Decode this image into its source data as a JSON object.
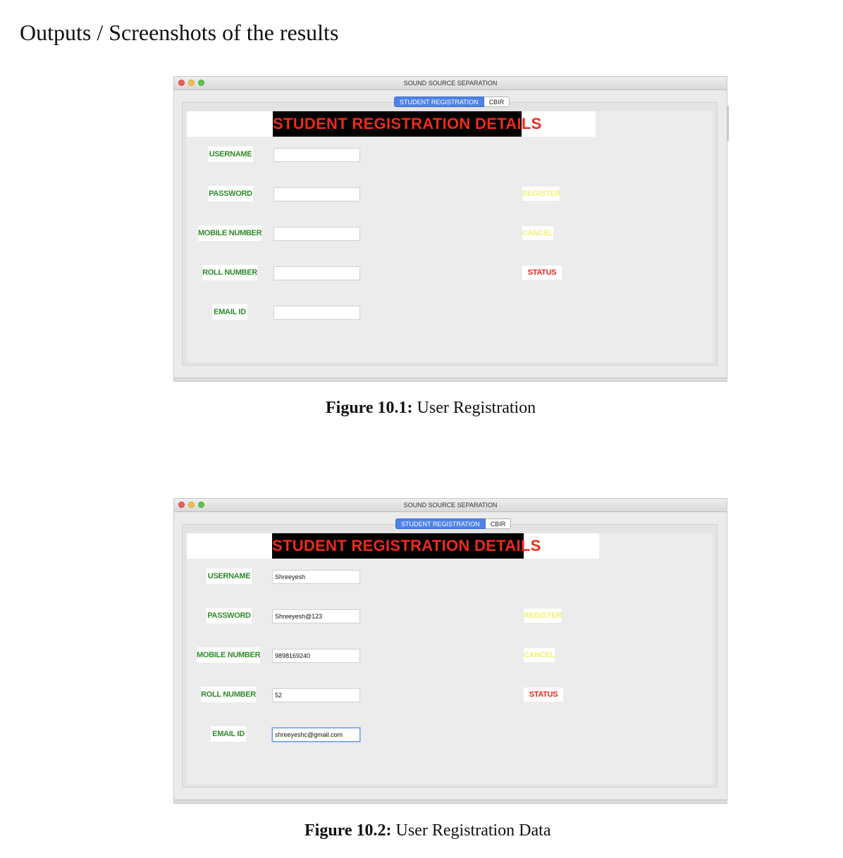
{
  "heading": "Outputs / Screenshots of the results",
  "figures": [
    {
      "window_title": "SOUND SOURCE SEPARATION",
      "tabs": {
        "active": "STUDENT REGISTRATION",
        "inactive": "CBIR"
      },
      "banner": "STUDENT REGISTRATION DETAILS",
      "fields": {
        "username": {
          "label": "USERNAME",
          "value": ""
        },
        "password": {
          "label": "PASSWORD",
          "value": ""
        },
        "mobile": {
          "label": "MOBILE NUMBER",
          "value": ""
        },
        "roll": {
          "label": "ROLL NUMBER",
          "value": ""
        },
        "email": {
          "label": "EMAIL ID",
          "value": ""
        }
      },
      "buttons": {
        "register": "REGISTER",
        "cancel": "CANCEL",
        "status": "STATUS"
      },
      "caption": {
        "number": "Figure  10.1:",
        "text": "User Registration"
      }
    },
    {
      "window_title": "SOUND SOURCE SEPARATION",
      "tabs": {
        "active": "STUDENT REGISTRATION",
        "inactive": "CBIR"
      },
      "banner": "STUDENT REGISTRATION DETAILS",
      "fields": {
        "username": {
          "label": "USERNAME",
          "value": "Shreeyesh"
        },
        "password": {
          "label": "PASSWORD",
          "value": "Shreeyesh@123"
        },
        "mobile": {
          "label": "MOBILE NUMBER",
          "value": "9898169240"
        },
        "roll": {
          "label": "ROLL NUMBER",
          "value": "52"
        },
        "email": {
          "label": "EMAIL ID",
          "value": "shreeyeshc@gmail.com"
        }
      },
      "buttons": {
        "register": "REGISTER",
        "cancel": "CANCEL",
        "status": "STATUS"
      },
      "caption": {
        "number": "Figure  10.2:",
        "text": "User Registration Data"
      }
    }
  ],
  "colors": {
    "banner_text": "#ee2a1c",
    "label_text": "#2f8a2a",
    "button_text": "#f2f07a",
    "status_text": "#e5261b",
    "active_tab": "#4e82e6"
  }
}
